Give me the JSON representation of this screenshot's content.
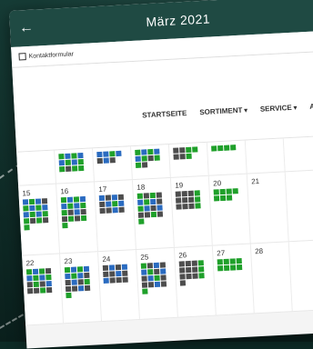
{
  "header": {
    "title": "März 2021",
    "back_icon": "arrow-left-icon",
    "forward_icon": "arrow-right-icon"
  },
  "subbar": {
    "label": "Kontaktformular"
  },
  "nav": {
    "items": [
      "STARTSEITE",
      "SORTIMENT",
      "SERVICE",
      "A"
    ]
  },
  "calendar": {
    "rows": [
      {
        "days": [
          "",
          "",
          "",
          "",
          "",
          "",
          ""
        ]
      },
      {
        "days": [
          "15",
          "16",
          "17",
          "18",
          "19",
          "20",
          "21"
        ]
      },
      {
        "days": [
          "22",
          "23",
          "24",
          "25",
          "26",
          "27",
          "28"
        ]
      }
    ]
  },
  "colors": {
    "available": "#1fa02a",
    "booked_blue": "#2a6bc0",
    "booked_dark": "#4d4d4d",
    "header": "#1f4a43"
  }
}
